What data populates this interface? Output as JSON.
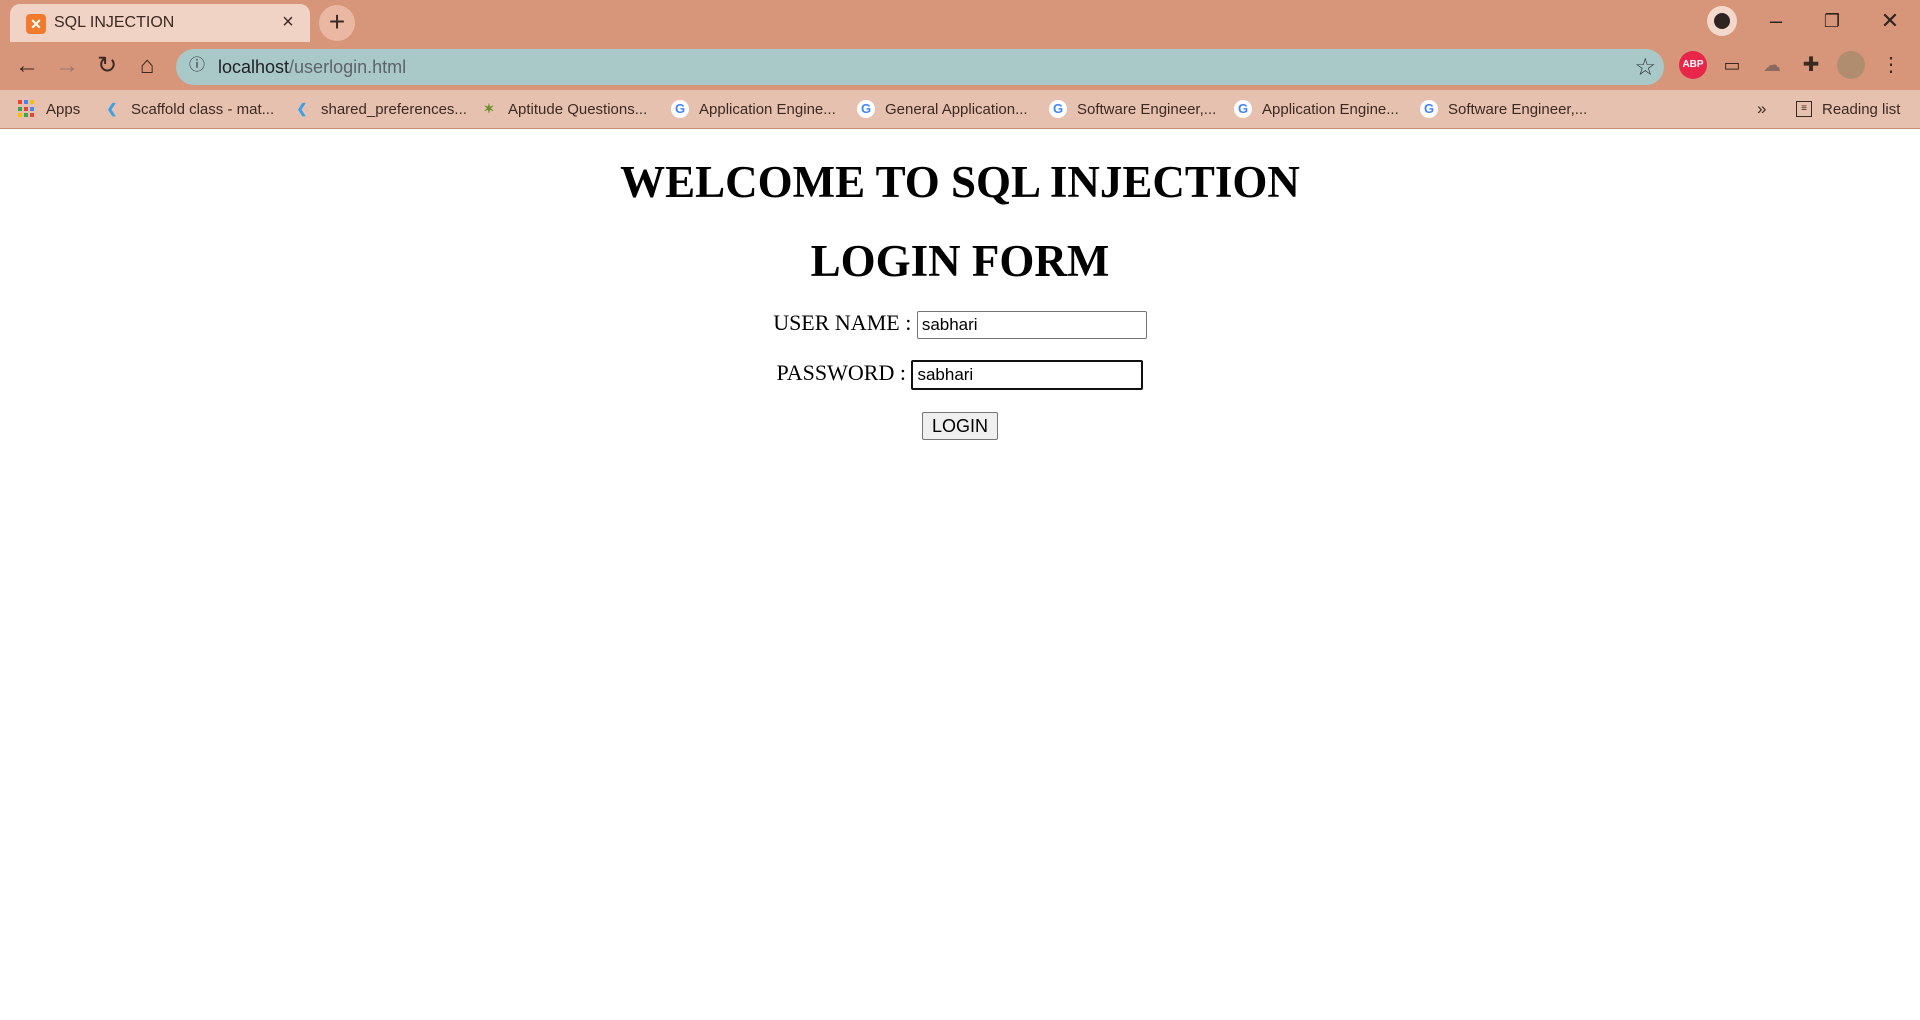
{
  "browser": {
    "tab_title": "SQL INJECTION",
    "url_host": "localhost",
    "url_path": "/userlogin.html",
    "bookmarks": [
      {
        "label": "Apps",
        "icon": "apps-icon"
      },
      {
        "label": "Scaffold class - mat...",
        "icon": "flutter-icon"
      },
      {
        "label": "shared_preferences...",
        "icon": "flutter-icon"
      },
      {
        "label": "Aptitude Questions...",
        "icon": "aptitude-icon"
      },
      {
        "label": "Application Engine...",
        "icon": "google-icon"
      },
      {
        "label": "General Application...",
        "icon": "google-icon"
      },
      {
        "label": "Software Engineer,...",
        "icon": "google-icon"
      },
      {
        "label": "Application Engine...",
        "icon": "google-icon"
      },
      {
        "label": "Software Engineer,...",
        "icon": "google-icon"
      }
    ],
    "more_bookmarks": "»",
    "reading_list": "Reading list",
    "adblock_label": "ABP"
  },
  "page": {
    "heading": "WELCOME TO SQL INJECTION",
    "subheading": "LOGIN FORM",
    "username_label": "USER NAME :",
    "username_value": "sabhari",
    "password_label": "PASSWORD :",
    "password_value": "sabhari",
    "login_button": "LOGIN"
  },
  "colors": {
    "chrome": "#d7957a",
    "tab": "#f1d3c5",
    "omnibox": "#a9c8c8",
    "bookmarks_bar": "#e7c1af"
  }
}
